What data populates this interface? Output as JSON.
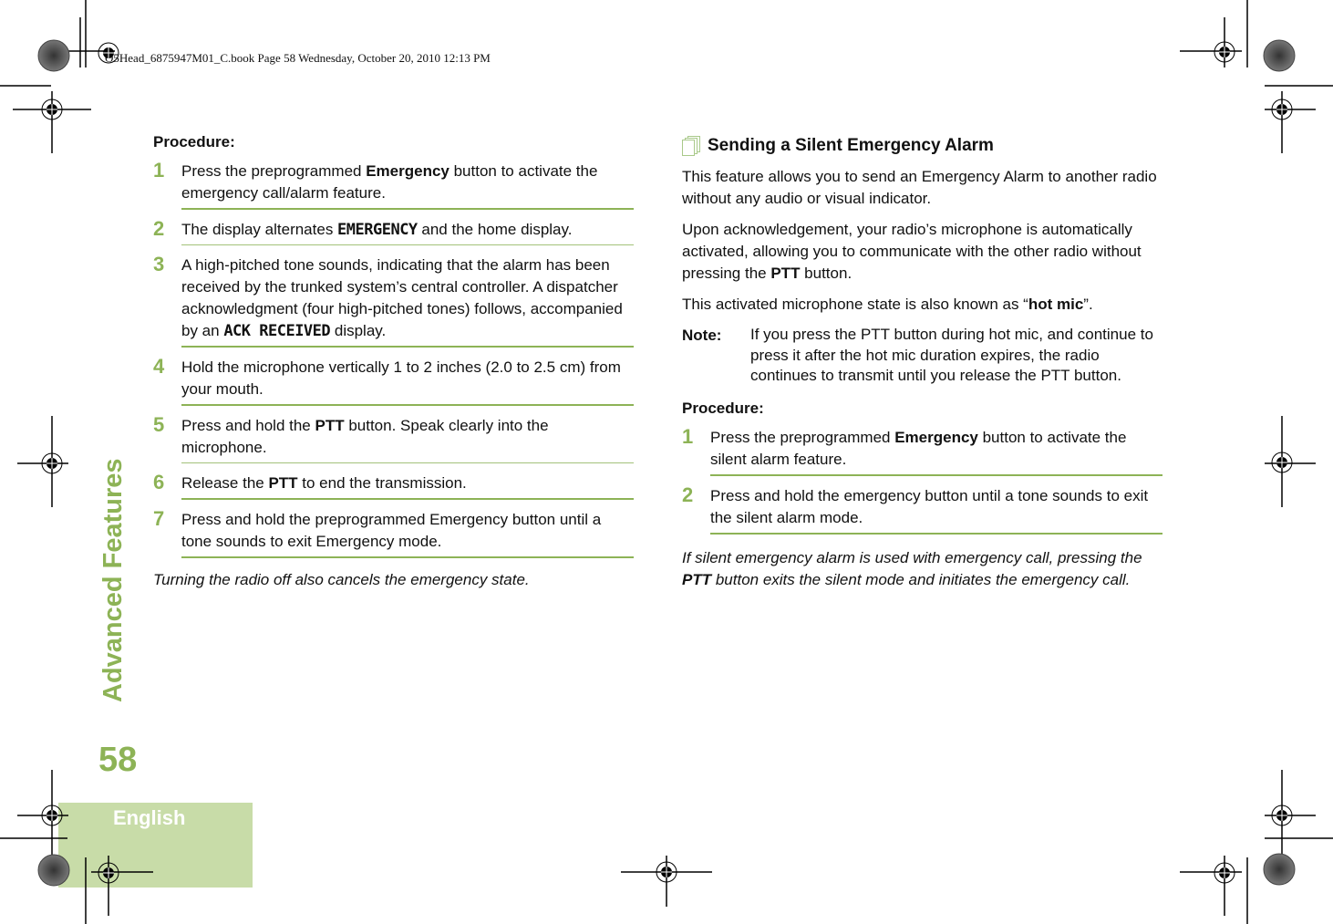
{
  "header": {
    "slug": "O5Head_6875947M01_C.book  Page 58  Wednesday, October 20, 2010  12:13 PM"
  },
  "side": {
    "section_title": "Advanced Features",
    "page_number": "58",
    "language": "English"
  },
  "colors": {
    "accent_green": "#8db356",
    "tab_green": "#c8dca8",
    "text": "#111111"
  },
  "left": {
    "procedure_label": "Procedure:",
    "steps": [
      {
        "num": "1",
        "pre": "Press the preprogrammed ",
        "bold": "Emergency",
        "post": " button to activate the emergency call/alarm feature."
      },
      {
        "num": "2",
        "pre": "The display alternates ",
        "display": "EMERGENCY",
        "post": " and the home display."
      },
      {
        "num": "3",
        "pre": "A high-pitched tone sounds, indicating that the alarm has been received by the trunked system’s central controller. A dispatcher acknowledgment (four high-pitched tones) follows, accompanied by an ",
        "display": "ACK RECEIVED",
        "post": " display."
      },
      {
        "num": "4",
        "pre": "Hold the microphone vertically 1 to 2 inches (2.0 to 2.5 cm) from your mouth."
      },
      {
        "num": "5",
        "pre": "Press and hold the ",
        "bold": "PTT",
        "post": " button. Speak clearly into the microphone."
      },
      {
        "num": "6",
        "pre": "Release the ",
        "bold": "PTT",
        "post": " to end the transmission."
      },
      {
        "num": "7",
        "pre": "Press and hold the preprogrammed Emergency button until a tone sounds to exit Emergency mode."
      }
    ],
    "footnote": "Turning the radio off also cancels the emergency state."
  },
  "right": {
    "heading": "Sending a Silent Emergency Alarm",
    "heading_icon": "document-stack-icon",
    "para1": "This feature allows you to send an Emergency Alarm to another radio without any audio or visual indicator.",
    "para2_pre": "Upon acknowledgement, your radio’s microphone is automatically activated, allowing you to communicate with the other radio without pressing the ",
    "para2_bold": "PTT",
    "para2_post": " button.",
    "para3_pre": "This activated microphone state is also known as “",
    "para3_bold": "hot mic",
    "para3_post": "”.",
    "note_label": "Note:",
    "note_text": "If you press the PTT button during hot mic, and continue to press it after the hot mic duration expires, the radio continues to transmit until you release the PTT button.",
    "procedure_label": "Procedure:",
    "steps": [
      {
        "num": "1",
        "pre": "Press the preprogrammed ",
        "bold": "Emergency",
        "post": " button to activate the silent alarm feature."
      },
      {
        "num": "2",
        "pre": "Press and hold the emergency button until a tone sounds to exit the silent alarm mode."
      }
    ],
    "footnote_pre": "If silent emergency alarm is used with emergency call, pressing the ",
    "footnote_bold": "PTT",
    "footnote_post": " button exits the silent mode and initiates the emergency call."
  }
}
